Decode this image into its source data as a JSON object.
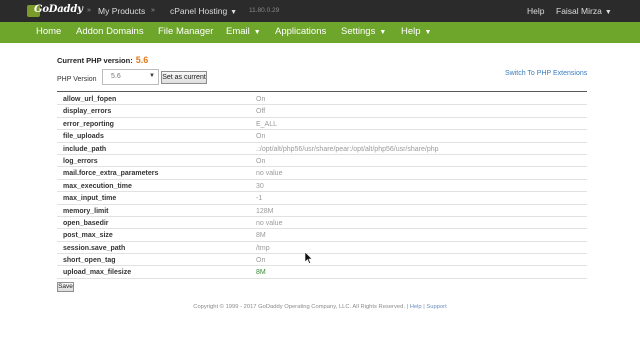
{
  "topbar": {
    "logo_text": "GoDaddy",
    "my_products": "My Products",
    "cpanel_hosting": "cPanel Hosting",
    "version": "11.80.0.29",
    "help": "Help",
    "user": "Faisal Mirza"
  },
  "nav": {
    "items": [
      "Home",
      "Addon Domains",
      "File Manager",
      "Email",
      "Applications",
      "Settings",
      "Help"
    ]
  },
  "php": {
    "current_label": "Current PHP version:",
    "current_value": "5.6",
    "version_label": "PHP Version",
    "selected": "5.6",
    "set_button": "Set as current",
    "switch_link": "Switch To PHP Extensions"
  },
  "settings": [
    {
      "name": "allow_url_fopen",
      "value": "On"
    },
    {
      "name": "display_errors",
      "value": "Off"
    },
    {
      "name": "error_reporting",
      "value": "E_ALL"
    },
    {
      "name": "file_uploads",
      "value": "On"
    },
    {
      "name": "include_path",
      "value": ".:/opt/alt/php56/usr/share/pear:/opt/alt/php56/usr/share/php"
    },
    {
      "name": "log_errors",
      "value": "On"
    },
    {
      "name": "mail.force_extra_parameters",
      "value": "no value"
    },
    {
      "name": "max_execution_time",
      "value": "30"
    },
    {
      "name": "max_input_time",
      "value": "-1"
    },
    {
      "name": "memory_limit",
      "value": "128M"
    },
    {
      "name": "open_basedir",
      "value": "no value"
    },
    {
      "name": "post_max_size",
      "value": "8M"
    },
    {
      "name": "session.save_path",
      "value": "/tmp"
    },
    {
      "name": "short_open_tag",
      "value": "On"
    },
    {
      "name": "upload_max_filesize",
      "value": "8M"
    }
  ],
  "save_button": "Save",
  "footer": {
    "copyright": "Copyright © 1999 - 2017 GoDaddy Operating Company, LLC. All Rights Reserved.",
    "sep": "|",
    "help": "Help",
    "support": "Support"
  },
  "colors": {
    "topbar": "#2b2b2b",
    "nav": "#6ea52b",
    "accent_orange": "#e07a1e",
    "link_blue": "#3a7bbf"
  }
}
